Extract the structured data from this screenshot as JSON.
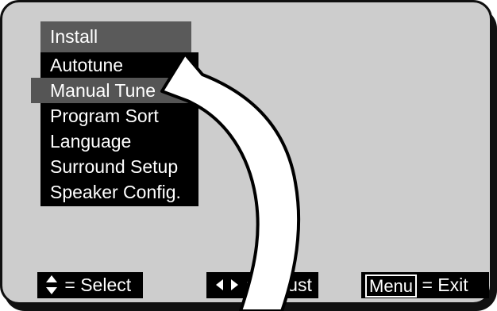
{
  "menu": {
    "title": "Install",
    "items": [
      {
        "label": "Autotune"
      },
      {
        "label": "Manual Tune"
      },
      {
        "label": "Program Sort"
      },
      {
        "label": "Language"
      },
      {
        "label": "Surround Setup"
      },
      {
        "label": "Speaker Config."
      }
    ],
    "selected_label": "Manual Tune"
  },
  "hints": {
    "select": {
      "icon": "up-down-arrows-icon",
      "text": "= Select"
    },
    "adjust": {
      "icon": "left-right-arrows-icon",
      "text": "= Adjust"
    },
    "exit": {
      "key": "Menu",
      "text": "= Exit"
    }
  },
  "colors": {
    "screen_background": "#cdcdcd",
    "menu_background": "#000000",
    "title_background": "#5a5a5a",
    "selected_background": "#555555",
    "text": "#ffffff",
    "callout_arrow": "#ffffff"
  }
}
